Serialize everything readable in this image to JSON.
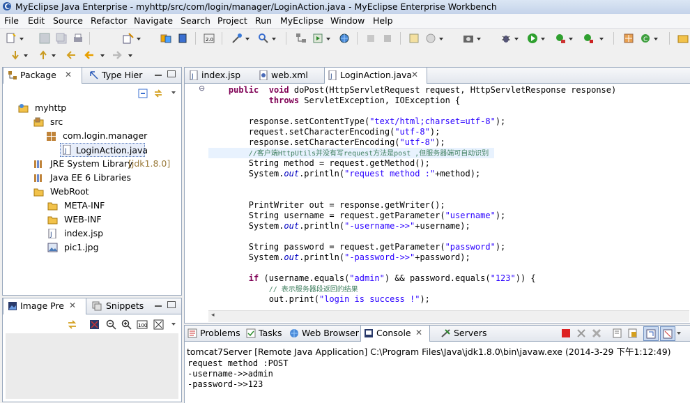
{
  "window": {
    "title": "MyEclipse Java Enterprise - myhttp/src/com/login/manager/LoginAction.java - MyEclipse Enterprise Workbench"
  },
  "menu": [
    "File",
    "Edit",
    "Source",
    "Refactor",
    "Navigate",
    "Search",
    "Project",
    "Run",
    "MyEclipse",
    "Window",
    "Help"
  ],
  "left_panel": {
    "tabs": [
      {
        "label": "Package",
        "icon": "package-explorer-icon",
        "active": true
      },
      {
        "label": "Type Hier",
        "icon": "type-hierarchy-icon",
        "active": false
      }
    ],
    "tree": [
      {
        "label": "myhttp",
        "icon": "project-icon",
        "level": 0
      },
      {
        "label": "src",
        "icon": "source-folder-icon",
        "level": 1
      },
      {
        "label": "com.login.manager",
        "icon": "package-icon",
        "level": 2
      },
      {
        "label": "LoginAction.java",
        "icon": "java-file-icon",
        "level": 3,
        "selected": true
      },
      {
        "label": "JRE System Library",
        "suffix": "[jdk1.8.0]",
        "icon": "library-icon",
        "level": 1
      },
      {
        "label": "Java EE 6 Libraries",
        "icon": "library-icon",
        "level": 1
      },
      {
        "label": "WebRoot",
        "icon": "folder-icon",
        "level": 1
      },
      {
        "label": "META-INF",
        "icon": "folder-icon",
        "level": 2
      },
      {
        "label": "WEB-INF",
        "icon": "folder-icon",
        "level": 2
      },
      {
        "label": "index.jsp",
        "icon": "jsp-file-icon",
        "level": 2
      },
      {
        "label": "pic1.jpg",
        "icon": "image-file-icon",
        "level": 2
      }
    ]
  },
  "bottom_left_panel": {
    "tabs": [
      {
        "label": "Image Pre",
        "active": true
      },
      {
        "label": "Snippets",
        "active": false
      }
    ]
  },
  "editor": {
    "tabs": [
      {
        "label": "index.jsp",
        "active": false
      },
      {
        "label": "web.xml",
        "active": false
      },
      {
        "label": "LoginAction.java",
        "active": true
      }
    ],
    "lines": [
      {
        "indent": "    ",
        "parts": [
          [
            "kw",
            "public"
          ],
          [
            "",
            "  "
          ],
          [
            "kw",
            "void"
          ],
          [
            "",
            " doPost(HttpServletRequest request, HttpServletResponse response)"
          ]
        ]
      },
      {
        "indent": "            ",
        "parts": [
          [
            "kw",
            "throws"
          ],
          [
            "",
            " ServletException, IOException {"
          ]
        ]
      },
      {
        "indent": "",
        "parts": []
      },
      {
        "indent": "        ",
        "parts": [
          [
            "",
            "response.setContentType("
          ],
          [
            "str",
            "\"text/html;charset=utf-8\""
          ],
          [
            "",
            ");"
          ]
        ]
      },
      {
        "indent": "        ",
        "parts": [
          [
            "",
            "request.setCharacterEncoding("
          ],
          [
            "str",
            "\"utf-8\""
          ],
          [
            "",
            ");"
          ]
        ]
      },
      {
        "indent": "        ",
        "parts": [
          [
            "",
            "response.setCharacterEncoding("
          ],
          [
            "str",
            "\"utf-8\""
          ],
          [
            "",
            ");"
          ]
        ]
      },
      {
        "indent": "        ",
        "parts": [
          [
            "cm",
            "//客户端HttpUtils并没有写request方法是post ,但服务器端可自动识别"
          ]
        ],
        "highlight": true
      },
      {
        "indent": "        ",
        "parts": [
          [
            "",
            "String method = request.getMethod();"
          ]
        ]
      },
      {
        "indent": "        ",
        "parts": [
          [
            "",
            "System."
          ],
          [
            "it",
            "out"
          ],
          [
            "",
            ".println("
          ],
          [
            "str",
            "\"request method :\""
          ],
          [
            "",
            "+method);"
          ]
        ]
      },
      {
        "indent": "",
        "parts": []
      },
      {
        "indent": "",
        "parts": []
      },
      {
        "indent": "        ",
        "parts": [
          [
            "",
            "PrintWriter out = response.getWriter();"
          ]
        ]
      },
      {
        "indent": "        ",
        "parts": [
          [
            "",
            "String username = request.getParameter("
          ],
          [
            "str",
            "\"username\""
          ],
          [
            "",
            ");"
          ]
        ]
      },
      {
        "indent": "        ",
        "parts": [
          [
            "",
            "System."
          ],
          [
            "it",
            "out"
          ],
          [
            "",
            ".println("
          ],
          [
            "str",
            "\"-username->>\""
          ],
          [
            "",
            "+username);"
          ]
        ]
      },
      {
        "indent": "",
        "parts": []
      },
      {
        "indent": "        ",
        "parts": [
          [
            "",
            "String password = request.getParameter("
          ],
          [
            "str",
            "\"password\""
          ],
          [
            "",
            ");"
          ]
        ]
      },
      {
        "indent": "        ",
        "parts": [
          [
            "",
            "System."
          ],
          [
            "it",
            "out"
          ],
          [
            "",
            ".println("
          ],
          [
            "str",
            "\"-password->>\""
          ],
          [
            "",
            "+password);"
          ]
        ]
      },
      {
        "indent": "",
        "parts": []
      },
      {
        "indent": "        ",
        "parts": [
          [
            "kw",
            "if"
          ],
          [
            "",
            " (username.equals("
          ],
          [
            "str",
            "\"admin\""
          ],
          [
            "",
            ") && password.equals("
          ],
          [
            "str",
            "\"123\""
          ],
          [
            "",
            ")) {"
          ]
        ]
      },
      {
        "indent": "            ",
        "parts": [
          [
            "cm",
            "// 表示服务器段返回的结果"
          ]
        ]
      },
      {
        "indent": "            ",
        "parts": [
          [
            "",
            "out.print("
          ],
          [
            "str",
            "\"login is success !\""
          ],
          [
            "",
            ");"
          ]
        ]
      }
    ]
  },
  "console_panel": {
    "tabs": [
      {
        "label": "Problems",
        "active": false
      },
      {
        "label": "Tasks",
        "active": false
      },
      {
        "label": "Web Browser",
        "active": false
      },
      {
        "label": "Console",
        "active": true
      },
      {
        "label": "Servers",
        "active": false
      }
    ],
    "header": "tomcat7Server [Remote Java Application] C:\\Program Files\\Java\\jdk1.8.0\\bin\\javaw.exe (2014-3-29 下午1:12:49)",
    "output": [
      "request method :POST",
      "-username->>admin",
      "-password->>123"
    ]
  }
}
